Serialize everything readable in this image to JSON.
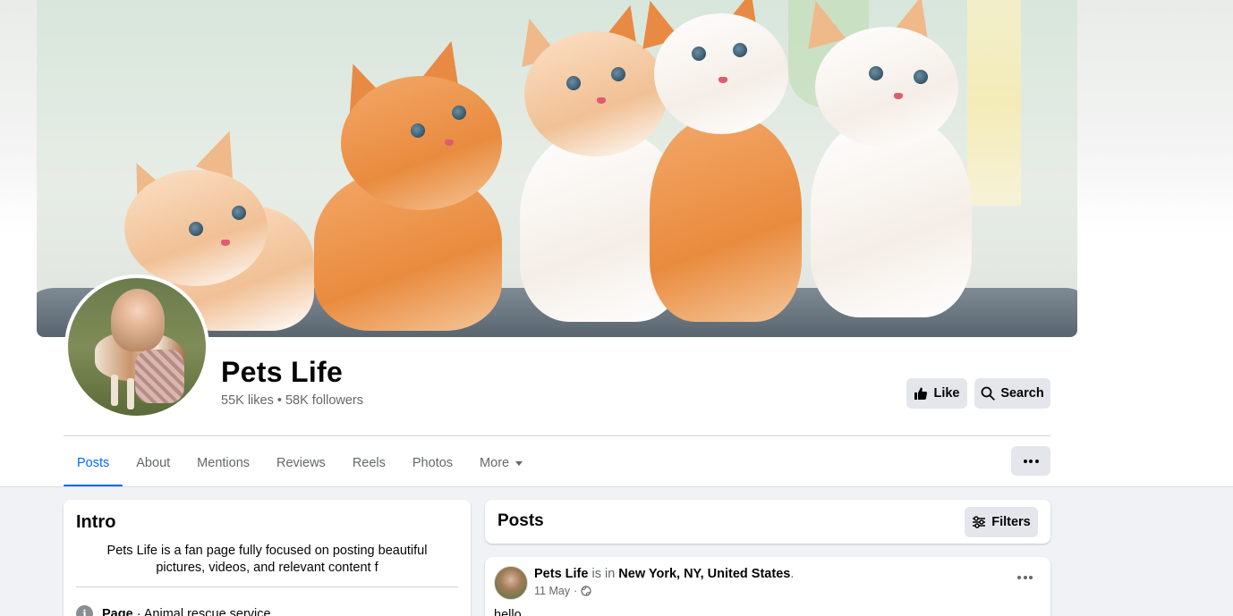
{
  "page": {
    "name": "Pets Life",
    "stats": "55K likes • 58K followers"
  },
  "actions": {
    "like_label": "Like",
    "search_label": "Search"
  },
  "tabs": [
    {
      "label": "Posts",
      "active": true
    },
    {
      "label": "About"
    },
    {
      "label": "Mentions"
    },
    {
      "label": "Reviews"
    },
    {
      "label": "Reels"
    },
    {
      "label": "Photos"
    },
    {
      "label": "More"
    }
  ],
  "intro": {
    "title": "Intro",
    "bio": "Pets Life is a fan page fully focused on posting beautiful pictures, videos, and relevant content f",
    "category_label": "Page",
    "category_value": " · Animal rescue service"
  },
  "posts_section": {
    "title": "Posts",
    "filters_label": "Filters"
  },
  "post": {
    "author": "Pets Life",
    "is_in": " is in ",
    "location": "New York, NY, United States",
    "period": ".",
    "date": "11 May",
    "separator": "·",
    "text": "hello"
  },
  "colors": {
    "accent": "#0866ff",
    "secondary_text": "#65676b",
    "button_bg": "#e4e6eb",
    "page_bg": "#f0f2f5"
  },
  "icons": {
    "like": "thumbs-up-icon",
    "search": "search-icon",
    "more": "more-dots-icon",
    "filters": "filter-sliders-icon",
    "info": "info-icon",
    "privacy": "globe-icon",
    "dropdown": "caret-down-icon"
  }
}
